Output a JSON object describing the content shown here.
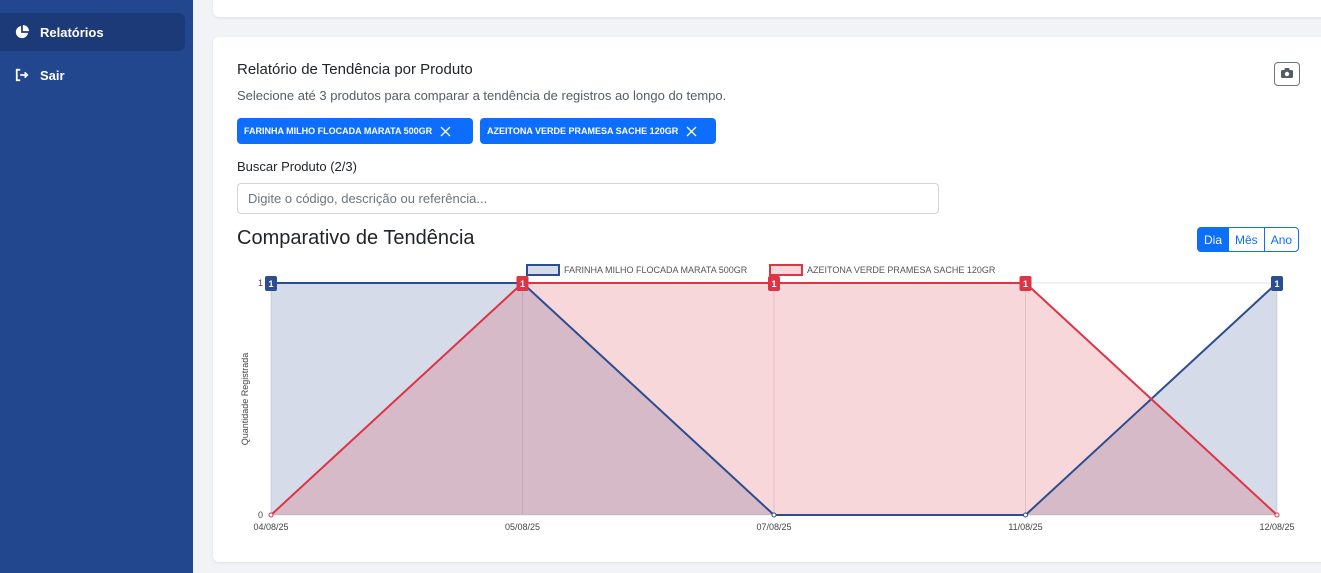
{
  "sidebar": {
    "items": [
      {
        "label": "Relatórios",
        "icon": "pie-chart-icon"
      },
      {
        "label": "Sair",
        "icon": "sign-out-icon"
      }
    ]
  },
  "report": {
    "title": "Relatório de Tendência por Produto",
    "subtitle": "Selecione até 3 produtos para comparar a tendência de registros ao longo do tempo.",
    "selected_products": [
      "FARINHA MILHO FLOCADA MARATA 500GR",
      "AZEITONA VERDE PRAMESA SACHE 120GR"
    ],
    "search_label": "Buscar Produto (2/3)",
    "search_placeholder": "Digite o código, descrição ou referência...",
    "chart_title": "Comparativo de Tendência",
    "periods": [
      "Dia",
      "Mês",
      "Ano"
    ],
    "active_period": "Dia"
  },
  "colors": {
    "sidebar": "#23478f",
    "accent": "#0d6efd",
    "series_blue": "#2c4d8f",
    "series_red": "#dc3545"
  },
  "chart_data": {
    "type": "area",
    "x": [
      "04/08/25",
      "05/08/25",
      "07/08/25",
      "11/08/25",
      "12/08/25"
    ],
    "ylabel": "Quantidade Registrada",
    "ylim": [
      0,
      1
    ],
    "yticks": [
      0,
      1
    ],
    "legend": "top",
    "series": [
      {
        "name": "FARINHA MILHO FLOCADA MARATA 500GR",
        "values": [
          1,
          1,
          0,
          0,
          1
        ],
        "color": "#2c4d8f"
      },
      {
        "name": "AZEITONA VERDE PRAMESA SACHE 120GR",
        "values": [
          0,
          1,
          1,
          1,
          0
        ],
        "color": "#dc3545"
      }
    ]
  }
}
